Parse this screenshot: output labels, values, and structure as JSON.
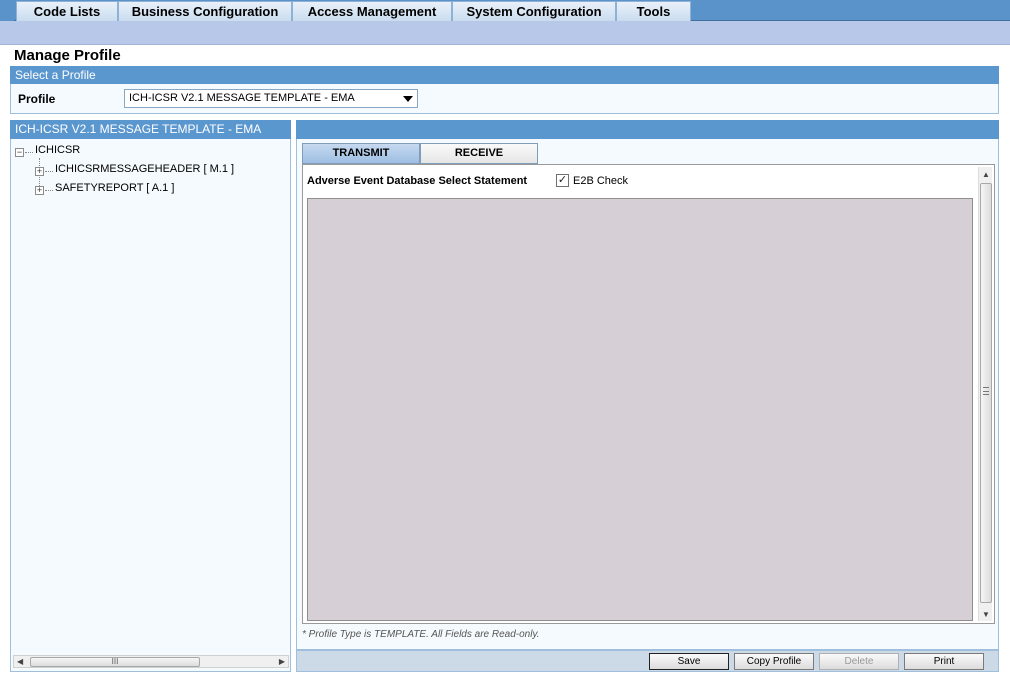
{
  "menu": {
    "items": [
      {
        "label": "Code Lists"
      },
      {
        "label": "Business Configuration"
      },
      {
        "label": "Access Management"
      },
      {
        "label": "System Configuration"
      },
      {
        "label": "Tools"
      }
    ]
  },
  "page": {
    "title": "Manage Profile"
  },
  "select_profile": {
    "header": "Select a Profile",
    "profile_label": "Profile",
    "profile_value": "ICH-ICSR V2.1 MESSAGE TEMPLATE - EMA"
  },
  "tree": {
    "header": "ICH-ICSR V2.1 MESSAGE TEMPLATE - EMA",
    "root": "ICHICSR",
    "children": [
      {
        "label": "ICHICSRMESSAGEHEADER [ M.1 ]"
      },
      {
        "label": "SAFETYREPORT [ A.1 ]"
      }
    ]
  },
  "detail": {
    "tabs": [
      {
        "label": "TRANSMIT",
        "active": true
      },
      {
        "label": "RECEIVE",
        "active": false
      }
    ],
    "statement_label": "Adverse Event Database Select Statement",
    "e2b_check_label": "E2B Check",
    "e2b_checked": true,
    "footnote": "* Profile Type is TEMPLATE. All Fields are Read-only."
  },
  "actions": {
    "save": "Save",
    "copy_profile": "Copy Profile",
    "delete": "Delete",
    "print": "Print"
  },
  "icons": {
    "expand": "+",
    "collapse": "−",
    "check": "✓",
    "grip": "III"
  }
}
